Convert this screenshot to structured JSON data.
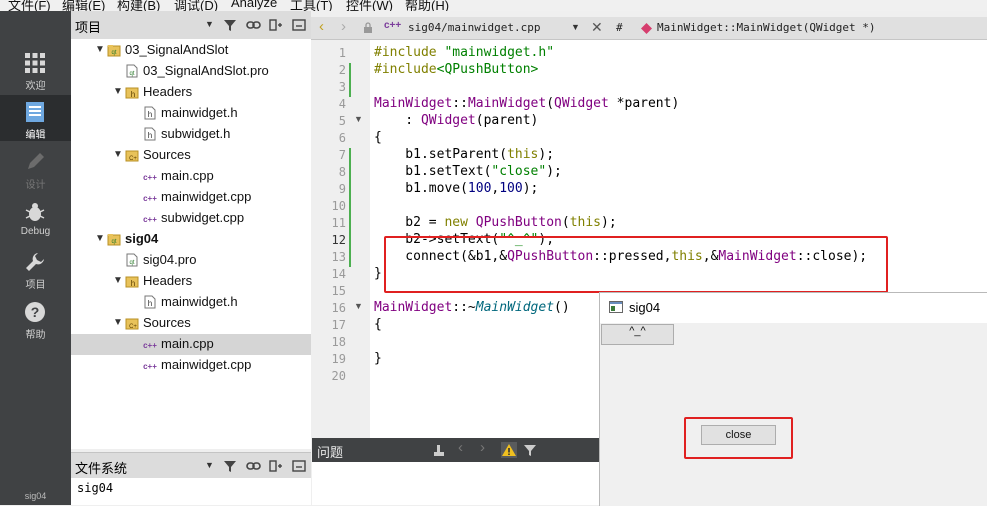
{
  "menu": [
    "文件(F)",
    "编辑(E)",
    "构建(B)",
    "调试(D)",
    "Analyze",
    "工具(T)",
    "控件(W)",
    "帮助(H)"
  ],
  "modes": [
    {
      "label": "欢迎",
      "icon": "grid-icon"
    },
    {
      "label": "编辑",
      "icon": "document-icon"
    },
    {
      "label": "设计",
      "icon": "pencil-icon"
    },
    {
      "label": "Debug",
      "icon": "bug-icon"
    },
    {
      "label": "项目",
      "icon": "wrench-icon"
    },
    {
      "label": "帮助",
      "icon": "help-icon"
    }
  ],
  "mode_bottom": "sig04",
  "project_pane": {
    "title": "项目"
  },
  "tree": [
    {
      "label": "03_SignalAndSlot",
      "icon": "project-folder-icon",
      "bold": false
    },
    {
      "label": "03_SignalAndSlot.pro",
      "icon": "pro-file-icon"
    },
    {
      "label": "Headers",
      "icon": "header-folder-icon"
    },
    {
      "label": "mainwidget.h",
      "icon": "header-file-icon"
    },
    {
      "label": "subwidget.h",
      "icon": "header-file-icon"
    },
    {
      "label": "Sources",
      "icon": "source-folder-icon"
    },
    {
      "label": "main.cpp",
      "icon": "cpp-file-icon"
    },
    {
      "label": "mainwidget.cpp",
      "icon": "cpp-file-icon"
    },
    {
      "label": "subwidget.cpp",
      "icon": "cpp-file-icon"
    },
    {
      "label": "sig04",
      "icon": "project-folder-icon",
      "bold": true
    },
    {
      "label": "sig04.pro",
      "icon": "pro-file-icon"
    },
    {
      "label": "Headers",
      "icon": "header-folder-icon"
    },
    {
      "label": "mainwidget.h",
      "icon": "header-file-icon"
    },
    {
      "label": "Sources",
      "icon": "source-folder-icon"
    },
    {
      "label": "main.cpp",
      "icon": "cpp-file-icon",
      "selected": true
    },
    {
      "label": "mainwidget.cpp",
      "icon": "cpp-file-icon"
    }
  ],
  "fs_pane": {
    "title": "文件系统",
    "path": "sig04"
  },
  "editor": {
    "file": "sig04/mainwidget.cpp",
    "hash": "#",
    "symbol": "MainWidget::MainWidget(QWidget *)",
    "line_numbers": [
      "1",
      "2",
      "3",
      "4",
      "5",
      "6",
      "7",
      "8",
      "9",
      "10",
      "11",
      "12",
      "13",
      "14",
      "15",
      "16",
      "17",
      "18",
      "19",
      "20"
    ],
    "code": {
      "l1_a": "#include ",
      "l1_b": "\"mainwidget.h\"",
      "l2_a": "#include",
      "l2_b": "<QPushButton>",
      "l4_a": "MainWidget",
      "l4_b": "::",
      "l4_c": "MainWidget",
      "l4_d": "(",
      "l4_e": "QWidget",
      "l4_f": " *parent)",
      "l5_a": "    : ",
      "l5_b": "QWidget",
      "l5_c": "(parent)",
      "l6": "{",
      "l7_a": "    b1.setParent(",
      "l7_b": "this",
      "l7_c": ");",
      "l8_a": "    b1.setText(",
      "l8_b": "\"close\"",
      "l8_c": ");",
      "l9_a": "    b1.move(",
      "l9_b": "100",
      "l9_c": ",",
      "l9_d": "100",
      "l9_e": ");",
      "l11_a": "    b2 = ",
      "l11_b": "new",
      "l11_c": " ",
      "l11_d": "QPushButton",
      "l11_e": "(",
      "l11_f": "this",
      "l11_g": ");",
      "l12_a": "    b2->setText(",
      "l12_b": "\"^_^\"",
      "l12_c": ");",
      "l13_a": "    connect(&b1,&",
      "l13_b": "QPushButton",
      "l13_c": "::pressed,",
      "l13_d": "this",
      "l13_e": ",&",
      "l13_f": "MainWidget",
      "l13_g": "::close);",
      "l14": "}",
      "l16_a": "MainWidget",
      "l16_b": "::~",
      "l16_c": "MainWidget",
      "l16_d": "()",
      "l17": "{",
      "l19": "}"
    }
  },
  "issues": {
    "title": "问题"
  },
  "run_window": {
    "title": "sig04",
    "button_b2": "^_^",
    "button_b1": "close"
  },
  "colors": {
    "highlight_red": "#e02020",
    "modebar": "#404244",
    "change_marker": "#4caf50"
  }
}
